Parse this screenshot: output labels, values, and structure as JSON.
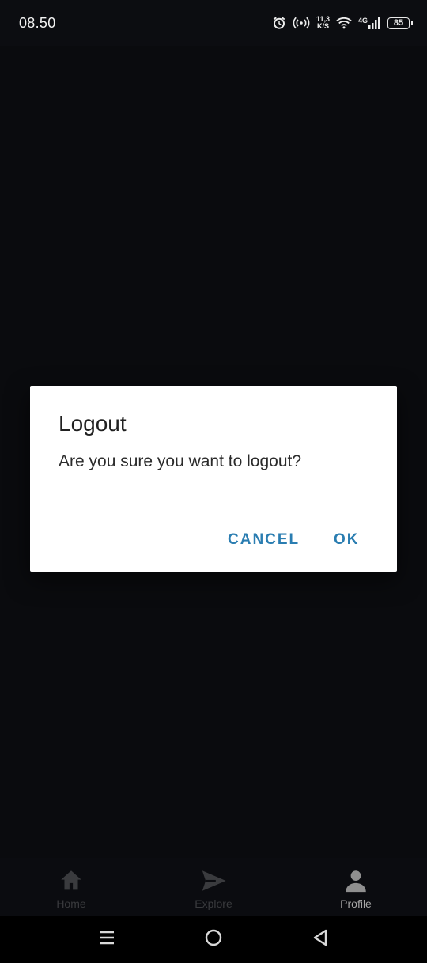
{
  "status_bar": {
    "time": "08.50",
    "net_speed_value": "11,3",
    "net_speed_unit": "K/S",
    "network_type": "4G",
    "battery_level": "85"
  },
  "dialog": {
    "title": "Logout",
    "message": "Are you sure you want to logout?",
    "cancel_label": "CANCEL",
    "ok_label": "OK",
    "button_color": "#2a7db1"
  },
  "bottom_nav": {
    "items": [
      {
        "label": "Home",
        "icon": "home-icon",
        "active": false
      },
      {
        "label": "Explore",
        "icon": "send-icon",
        "active": false
      },
      {
        "label": "Profile",
        "icon": "person-icon",
        "active": true
      }
    ]
  },
  "system_nav": {
    "icons": [
      "recent-apps-icon",
      "home-circle-icon",
      "back-triangle-icon"
    ]
  }
}
